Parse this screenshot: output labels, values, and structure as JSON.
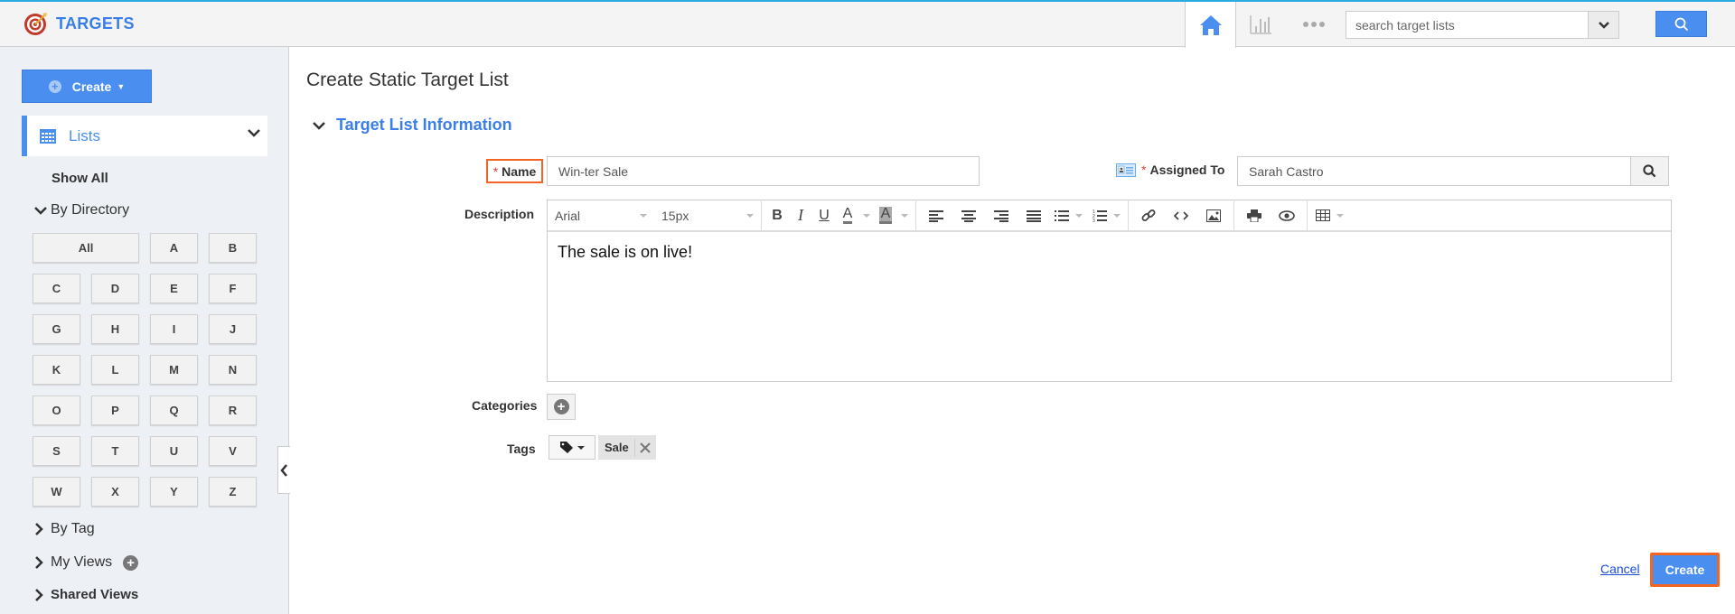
{
  "app": {
    "title": "TARGETS",
    "accent_color": "#4a8ef0",
    "brand_color": "#3a7fe8",
    "highlight_color": "#f26522"
  },
  "header": {
    "nav_icons": [
      "home-icon",
      "chart-icon",
      "more-icon"
    ],
    "search": {
      "placeholder": "search target lists",
      "value": ""
    }
  },
  "sidebar": {
    "create_label": "Create",
    "lists_label": "Lists",
    "show_all": "Show All",
    "by_directory": "By Directory",
    "letters": [
      "All",
      "A",
      "B",
      "C",
      "D",
      "E",
      "F",
      "G",
      "H",
      "I",
      "J",
      "K",
      "L",
      "M",
      "N",
      "O",
      "P",
      "Q",
      "R",
      "S",
      "T",
      "U",
      "V",
      "W",
      "X",
      "Y",
      "Z"
    ],
    "by_tag": "By Tag",
    "my_views": "My Views",
    "shared_views": "Shared Views"
  },
  "form": {
    "page_title": "Create Static Target List",
    "section_title": "Target List Information",
    "required_marker": "*",
    "name": {
      "label": "Name",
      "value": "Win-ter Sale"
    },
    "assigned_to": {
      "label": "Assigned To",
      "value": "Sarah Castro"
    },
    "description": {
      "label": "Description",
      "font": "Arial",
      "size": "15px",
      "content": "The sale is on live!"
    },
    "categories": {
      "label": "Categories"
    },
    "tags": {
      "label": "Tags",
      "items": [
        "Sale"
      ]
    },
    "cancel_label": "Cancel",
    "create_label": "Create"
  }
}
